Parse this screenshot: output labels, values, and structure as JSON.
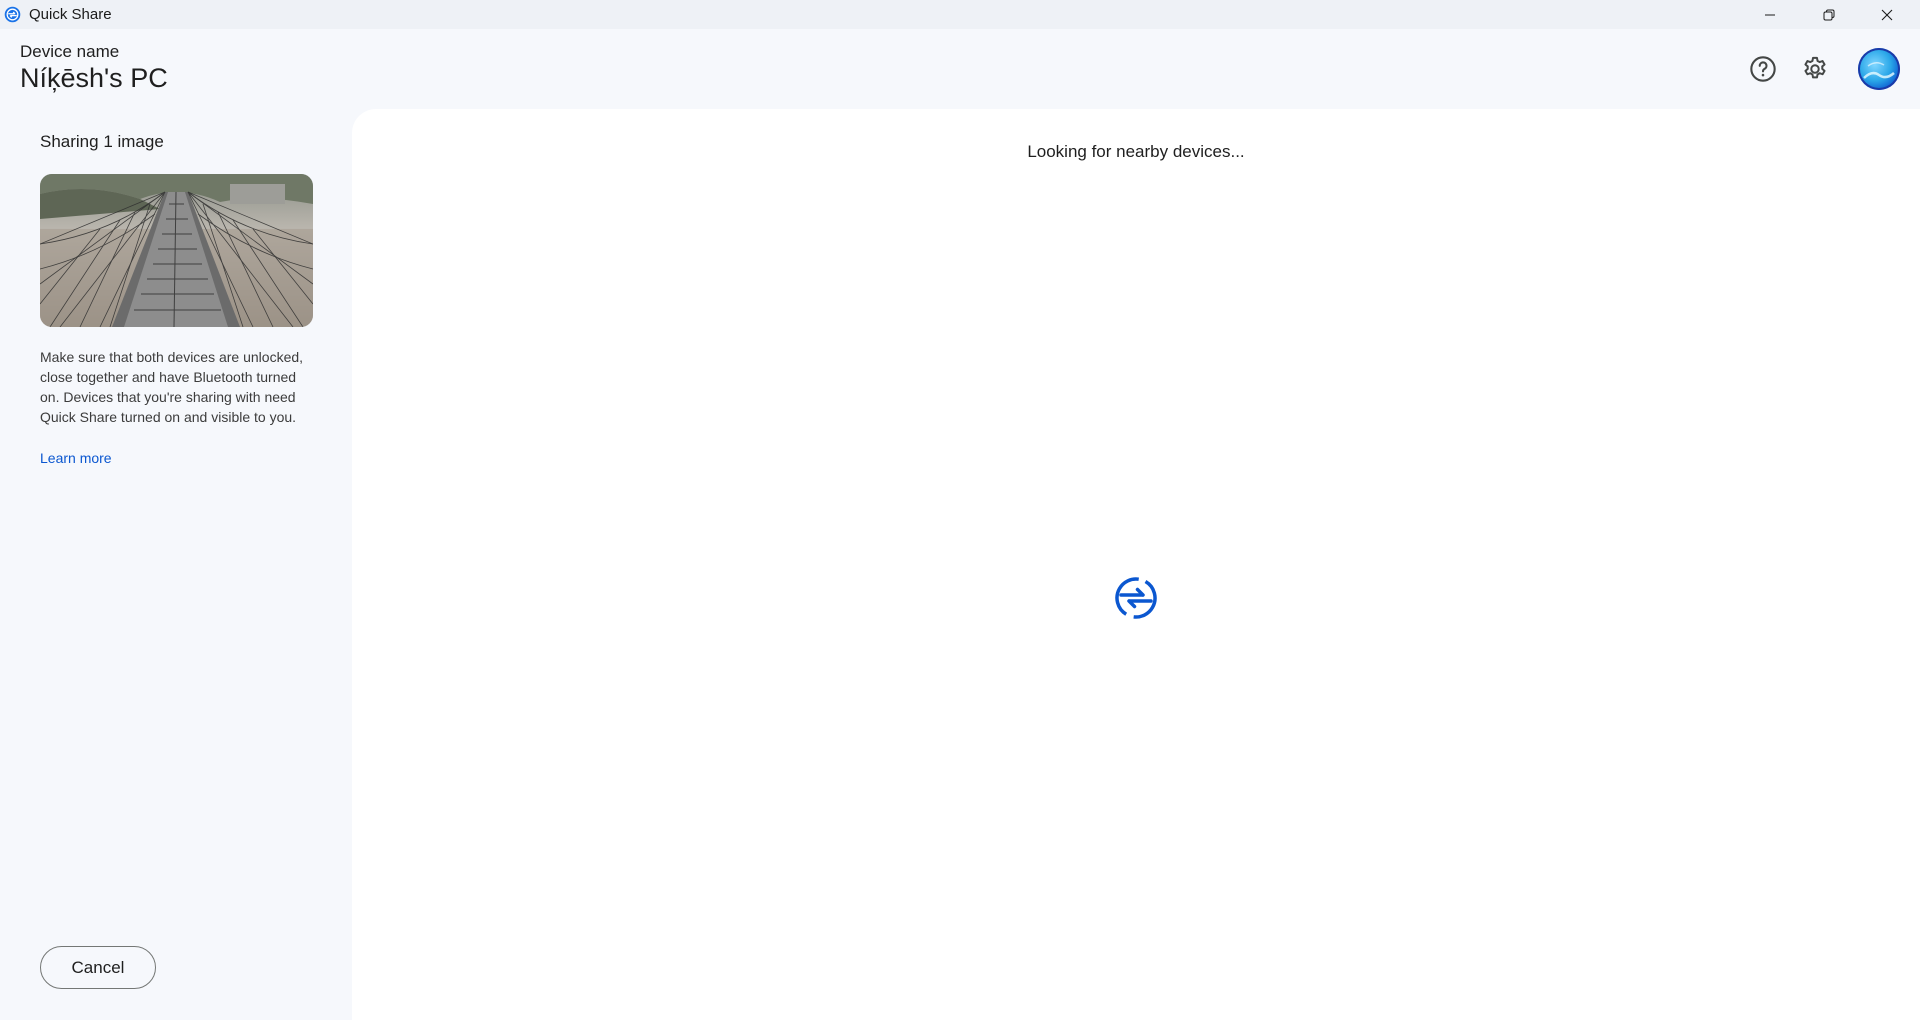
{
  "window": {
    "title": "Quick Share",
    "controls": [
      "minimize",
      "restore",
      "close"
    ]
  },
  "header": {
    "device_label": "Device name",
    "device_name": "Níķēsh's PC",
    "icons": [
      "help-icon",
      "settings-icon",
      "avatar"
    ]
  },
  "sidebar": {
    "sharing_title": "Sharing 1 image",
    "image_subject": "suspension bridge photo",
    "info_text": "Make sure that both devices are unlocked, close together and have Bluetooth turned on. Devices that you're sharing with need Quick Share turned on and visible to you.",
    "learn_more": "Learn more",
    "cancel_label": "Cancel"
  },
  "main": {
    "status": "Looking for nearby devices...",
    "center_icon": "quick-share-icon"
  },
  "colors": {
    "accent": "#0b57d0",
    "background": "#f6f8fc",
    "panel": "#ffffff"
  }
}
